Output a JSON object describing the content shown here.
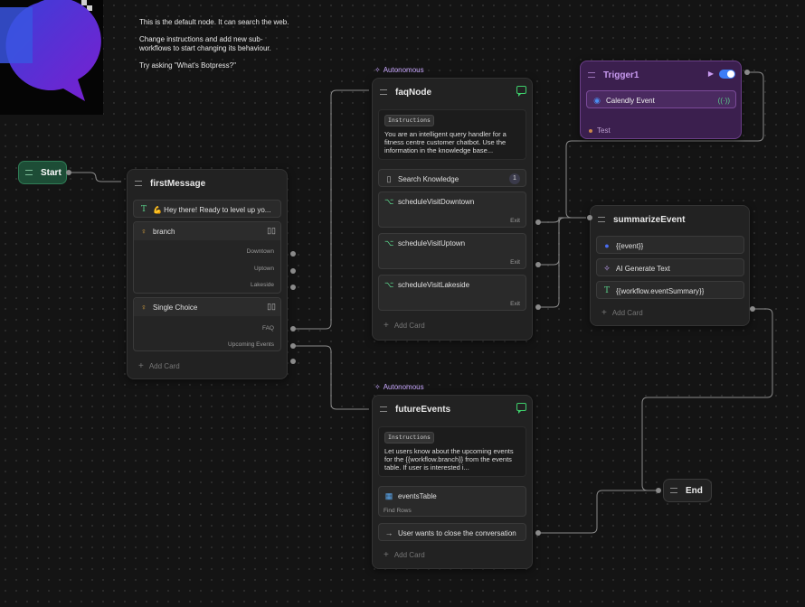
{
  "note": {
    "lines": [
      "This is the default node. It can search the web.",
      "Change instructions and add new sub-workflows to start changing its behaviour.",
      "Try asking \"What's Botpress?\""
    ]
  },
  "start": {
    "label": "Start"
  },
  "end": {
    "label": "End"
  },
  "firstMessage": {
    "title": "firstMessage",
    "text_card": "💪 Hey there! Ready to level up yo...",
    "branch": {
      "label": "branch",
      "options": [
        "Downtown",
        "Uptown",
        "Lakeside"
      ]
    },
    "choice": {
      "label": "Single Choice",
      "options": [
        "FAQ",
        "Upcoming Events"
      ]
    },
    "add_card": "Add Card"
  },
  "faqNode": {
    "badge": "Autonomous",
    "title": "faqNode",
    "instructions_tag": "Instructions",
    "instructions_text": "You are an intelligent query handler for a fitness centre customer chatbot. Use the information in the knowledge base...",
    "search": {
      "label": "Search Knowledge",
      "count": "1"
    },
    "subflows": [
      {
        "label": "scheduleVisitDowntown",
        "exit": "Exit"
      },
      {
        "label": "scheduleVisitUptown",
        "exit": "Exit"
      },
      {
        "label": "scheduleVisitLakeside",
        "exit": "Exit"
      }
    ],
    "add_card": "Add Card"
  },
  "futureEvents": {
    "badge": "Autonomous",
    "title": "futureEvents",
    "instructions_tag": "Instructions",
    "instructions_text": "Let users know about the upcoming events for the {{workflow.branch}} from the events table. If user is interested i...",
    "table": {
      "label": "eventsTable",
      "action": "Find Rows"
    },
    "transition": "User wants to close the conversation",
    "add_card": "Add Card"
  },
  "trigger": {
    "title": "Trigger1",
    "event": "Calendly Event",
    "test": "Test"
  },
  "summarizeEvent": {
    "title": "summarizeEvent",
    "cards": [
      "{{event}}",
      "AI Generate Text",
      "{{workflow.eventSummary}}"
    ],
    "add_card": "Add Card"
  },
  "colors": {
    "background": "#141414",
    "node": "#222222",
    "start": "#1d4d36",
    "trigger": "#3b1f4e",
    "autonomous": "#c9a8ff",
    "chat_icon": "#3ecf6b",
    "toggle": "#3b7df7"
  }
}
